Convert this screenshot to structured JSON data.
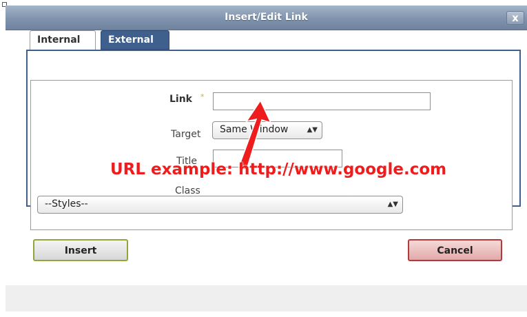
{
  "dialog": {
    "title": "Insert/Edit Link",
    "close_label": "x"
  },
  "tabs": [
    {
      "label": "Internal",
      "active": false
    },
    {
      "label": "External",
      "active": true
    }
  ],
  "form": {
    "link_label": "Link",
    "required_mark": "*",
    "link_value": "",
    "target_label": "Target",
    "target_value": "Same Window",
    "title_label": "Title",
    "title_value": "",
    "class_label": "Class",
    "class_value": "--Styles--"
  },
  "buttons": {
    "insert": "Insert",
    "cancel": "Cancel"
  },
  "annotation": {
    "text": "URL  example: http://www.google.com",
    "color": "#ee1c1c"
  },
  "colors": {
    "accent": "#3f5f8c",
    "insert_border": "#8ea63a",
    "cancel_border": "#b33a3a"
  }
}
